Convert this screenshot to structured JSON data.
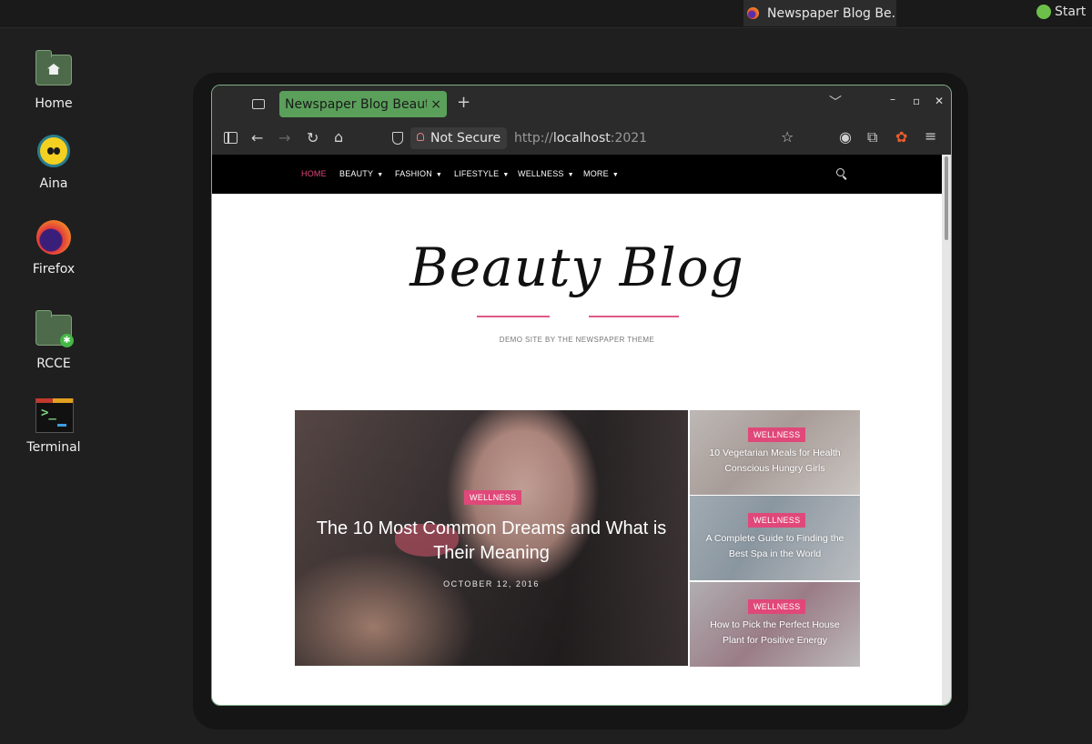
{
  "taskbar": {
    "window_title": "Newspaper Blog Be...",
    "start_label": "Start"
  },
  "desktop": {
    "icons": [
      {
        "label": "Home",
        "icon": "home-folder-icon"
      },
      {
        "label": "Aina",
        "icon": "aina-icon"
      },
      {
        "label": "Firefox",
        "icon": "firefox-icon"
      },
      {
        "label": "RCCE",
        "icon": "rcce-folder-icon"
      },
      {
        "label": "Terminal",
        "icon": "terminal-icon"
      }
    ]
  },
  "browser": {
    "tab_title": "Newspaper Blog Beauty",
    "tab_close": "×",
    "new_tab": "+",
    "security_label": "Not Secure",
    "url_scheme": "http://",
    "url_host": "localhost",
    "url_port": ":2021",
    "colors": {
      "frame": "#2b2b2b",
      "active_tab": "#5aa05a",
      "border": "#7fb08a"
    }
  },
  "site": {
    "menu": [
      {
        "label": "HOME",
        "has_caret": false,
        "active": true
      },
      {
        "label": "BEAUTY",
        "has_caret": true,
        "active": false
      },
      {
        "label": "FASHION",
        "has_caret": true,
        "active": false
      },
      {
        "label": "LIFESTYLE",
        "has_caret": true,
        "active": false
      },
      {
        "label": "WELLNESS",
        "has_caret": true,
        "active": false
      },
      {
        "label": "MORE",
        "has_caret": true,
        "active": false
      }
    ],
    "logo_text": "Beauty Blog",
    "tagline": "DEMO SITE BY THE NEWSPAPER THEME",
    "colors": {
      "accent": "#e0487a",
      "nav_bg": "#000000"
    },
    "featured": {
      "category": "WELLNESS",
      "title": "The 10 Most Common Dreams and What is Their Meaning",
      "date": "OCTOBER 12, 2016"
    },
    "side_posts": [
      {
        "category": "WELLNESS",
        "title": "10 Vegetarian Meals for Health Conscious Hungry Girls"
      },
      {
        "category": "WELLNESS",
        "title": "A Complete Guide to Finding the Best Spa in the World"
      },
      {
        "category": "WELLNESS",
        "title": "How to Pick the Perfect House Plant for Positive Energy"
      }
    ]
  }
}
